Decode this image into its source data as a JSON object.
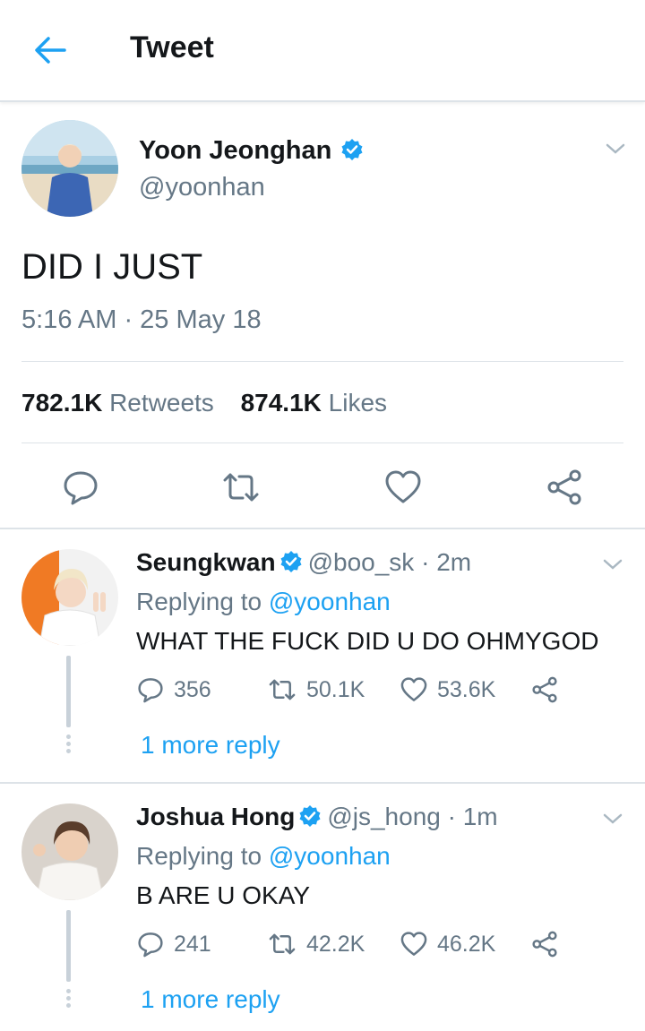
{
  "header": {
    "title": "Tweet"
  },
  "tweet": {
    "author_name": "Yoon Jeonghan",
    "handle": "@yoonhan",
    "text": "DID I JUST",
    "timestamp": "5:16 AM · 25 May 18",
    "retweets_count": "782.1K",
    "retweets_label": "Retweets",
    "likes_count": "874.1K",
    "likes_label": "Likes"
  },
  "replies": [
    {
      "name": "Seungkwan",
      "handle_time": "@boo_sk · 2m",
      "replying_prefix": "Replying to",
      "replying_to": "@yoonhan",
      "text": "WHAT THE FUCK DID U DO OHMYGOD",
      "reply_count": "356",
      "retweet_count": "50.1K",
      "like_count": "53.6K",
      "more_label": "1 more reply"
    },
    {
      "name": "Joshua Hong",
      "handle_time": "@js_hong · 1m",
      "replying_prefix": "Replying to",
      "replying_to": "@yoonhan",
      "text": "B ARE U OKAY",
      "reply_count": "241",
      "retweet_count": "42.2K",
      "like_count": "46.2K",
      "more_label": "1 more reply"
    }
  ],
  "colors": {
    "accent": "#1da1f2",
    "muted": "#657786",
    "text": "#14171a",
    "divider": "#dde3e8"
  },
  "icons": [
    "back-arrow-icon",
    "verified-badge-icon",
    "chevron-down-icon",
    "reply-icon",
    "retweet-icon",
    "like-icon",
    "share-icon"
  ]
}
